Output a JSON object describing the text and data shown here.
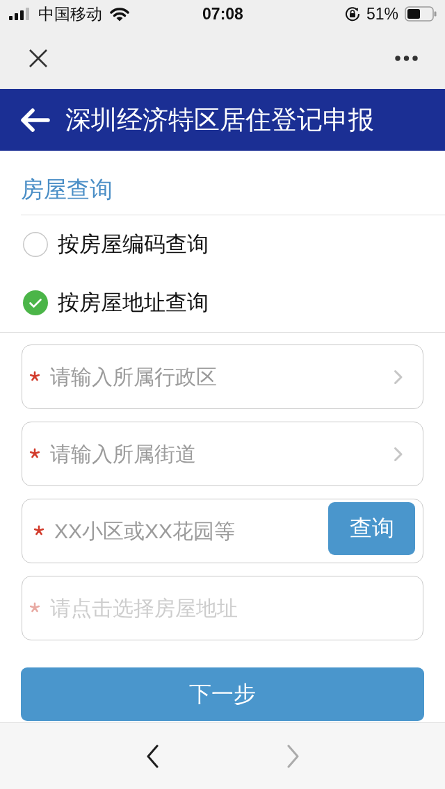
{
  "status_bar": {
    "carrier": "中国移动",
    "time": "07:08",
    "battery_percent": "51%"
  },
  "header": {
    "title": "深圳经济特区居住登记申报"
  },
  "section_title": "房屋查询",
  "query_modes": [
    {
      "label": "按房屋编码查询",
      "selected": false
    },
    {
      "label": "按房屋地址查询",
      "selected": true
    }
  ],
  "fields": [
    {
      "kind": "select",
      "placeholder": "请输入所属行政区",
      "required": true,
      "disabled": false
    },
    {
      "kind": "select",
      "placeholder": "请输入所属街道",
      "required": true,
      "disabled": false
    },
    {
      "kind": "search",
      "placeholder": "XX小区或XX花园等",
      "required": true,
      "disabled": false,
      "button": "查询"
    },
    {
      "kind": "picker",
      "placeholder": "请点击选择房屋地址",
      "required": true,
      "disabled": true
    }
  ],
  "next_button": "下一步",
  "toolbar": {
    "back_enabled": true,
    "forward_enabled": false
  }
}
